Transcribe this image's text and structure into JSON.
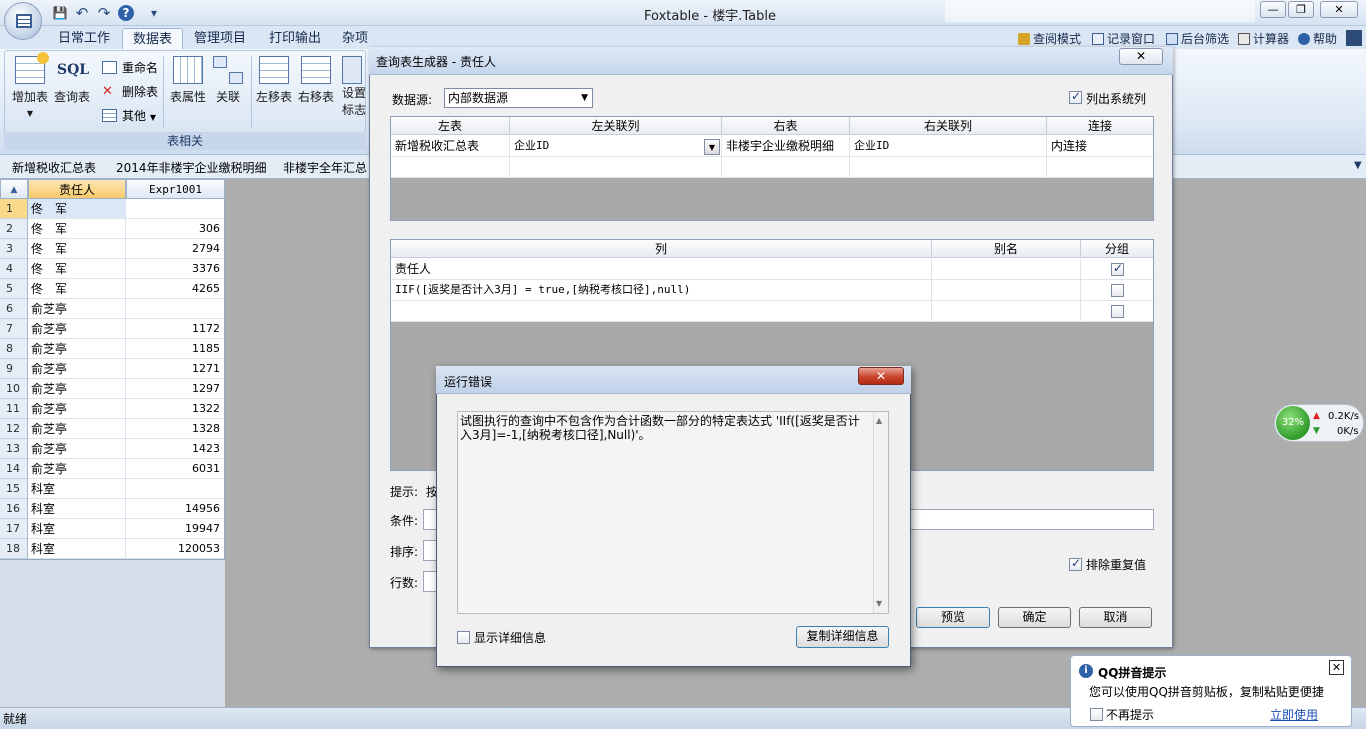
{
  "window": {
    "title": "Foxtable - 楼宇.Table"
  },
  "quick_access": {
    "save": "💾",
    "undo": "↶",
    "redo": "↷",
    "help": "?",
    "dropdown": "▾"
  },
  "window_controls": {
    "minimize": "—",
    "restore": "❐",
    "close": "✕"
  },
  "ribbon": {
    "tabs": [
      "日常工作",
      "数据表",
      "管理项目",
      "打印输出",
      "杂项"
    ],
    "active_tab": "数据表",
    "buttons": {
      "add_table": "增加表",
      "sql_icon": "SQL",
      "query_table": "查询表",
      "rename": "重命名",
      "delete_table": "删除表",
      "other": "其他",
      "table_props": "表属性",
      "relation": "关联",
      "move_left": "左移表",
      "move_right": "右移表",
      "setup_line1": "设置",
      "setup_line2": "标志"
    },
    "group_label": "表相关",
    "right_links": [
      "查阅模式",
      "记录窗口",
      "后台筛选",
      "计算器",
      "帮助"
    ]
  },
  "doc_tabs": [
    "新增税收汇总表",
    "2014年非楼宇企业缴税明细",
    "非楼宇全年汇总"
  ],
  "grid": {
    "columns": [
      "责任人",
      "Expr1001"
    ],
    "rows": [
      [
        "1",
        "佟　军",
        ""
      ],
      [
        "2",
        "佟　军",
        "306"
      ],
      [
        "3",
        "佟　军",
        "2794"
      ],
      [
        "4",
        "佟　军",
        "3376"
      ],
      [
        "5",
        "佟　军",
        "4265"
      ],
      [
        "6",
        "俞芝亭",
        ""
      ],
      [
        "7",
        "俞芝亭",
        "1172"
      ],
      [
        "8",
        "俞芝亭",
        "1185"
      ],
      [
        "9",
        "俞芝亭",
        "1271"
      ],
      [
        "10",
        "俞芝亭",
        "1297"
      ],
      [
        "11",
        "俞芝亭",
        "1322"
      ],
      [
        "12",
        "俞芝亭",
        "1328"
      ],
      [
        "13",
        "俞芝亭",
        "1423"
      ],
      [
        "14",
        "俞芝亭",
        "6031"
      ],
      [
        "15",
        "科室",
        ""
      ],
      [
        "16",
        "科室",
        "14956"
      ],
      [
        "17",
        "科室",
        "19947"
      ],
      [
        "18",
        "科室",
        "120053"
      ]
    ]
  },
  "status": {
    "text": "就绪"
  },
  "network": {
    "percent": "32%",
    "up": "0.2K/s",
    "down": "0K/s"
  },
  "query_dialog": {
    "title": "查询表生成器 - 责任人",
    "close": "✕",
    "datasource_label": "数据源:",
    "datasource_value": "内部数据源",
    "list_system_label": "列出系统列",
    "list_system_checked": true,
    "join_headers": [
      "左表",
      "左关联列",
      "右表",
      "右关联列",
      "连接"
    ],
    "join_rows": [
      [
        "新增税收汇总表",
        "企业ID",
        "非楼宇企业缴税明细",
        "企业ID",
        "内连接"
      ]
    ],
    "col_headers": [
      "列",
      "别名",
      "分组"
    ],
    "col_rows": [
      {
        "expr": "责任人",
        "alias": "",
        "group": true
      },
      {
        "expr": "IIF([返奖是否计入3月] = true,[纳税考核口径],null)",
        "alias": "",
        "group": false
      },
      {
        "expr": "",
        "alias": "",
        "group": false
      }
    ],
    "hint_label": "提示:",
    "hint_value": "按",
    "condition_label": "条件:",
    "sort_label": "排序:",
    "rows_label": "行数:",
    "distinct_label": "排除重复值",
    "distinct_checked": true,
    "preview_btn": "预览",
    "ok_btn": "确定",
    "cancel_btn": "取消"
  },
  "error_dialog": {
    "title": "运行错误",
    "close": "✕",
    "message": "试图执行的查询中不包含作为合计函数一部分的特定表达式 'IIf([返奖是否计入3月]=-1,[纳税考核口径],Null)'。",
    "show_detail_label": "显示详细信息",
    "copy_detail_btn": "复制详细信息"
  },
  "qq_popup": {
    "title": "QQ拼音提示",
    "close": "✕",
    "message": "您可以使用QQ拼音剪贴板，复制粘贴更便捷",
    "no_remind": "不再提示",
    "use_now": "立即使用"
  }
}
